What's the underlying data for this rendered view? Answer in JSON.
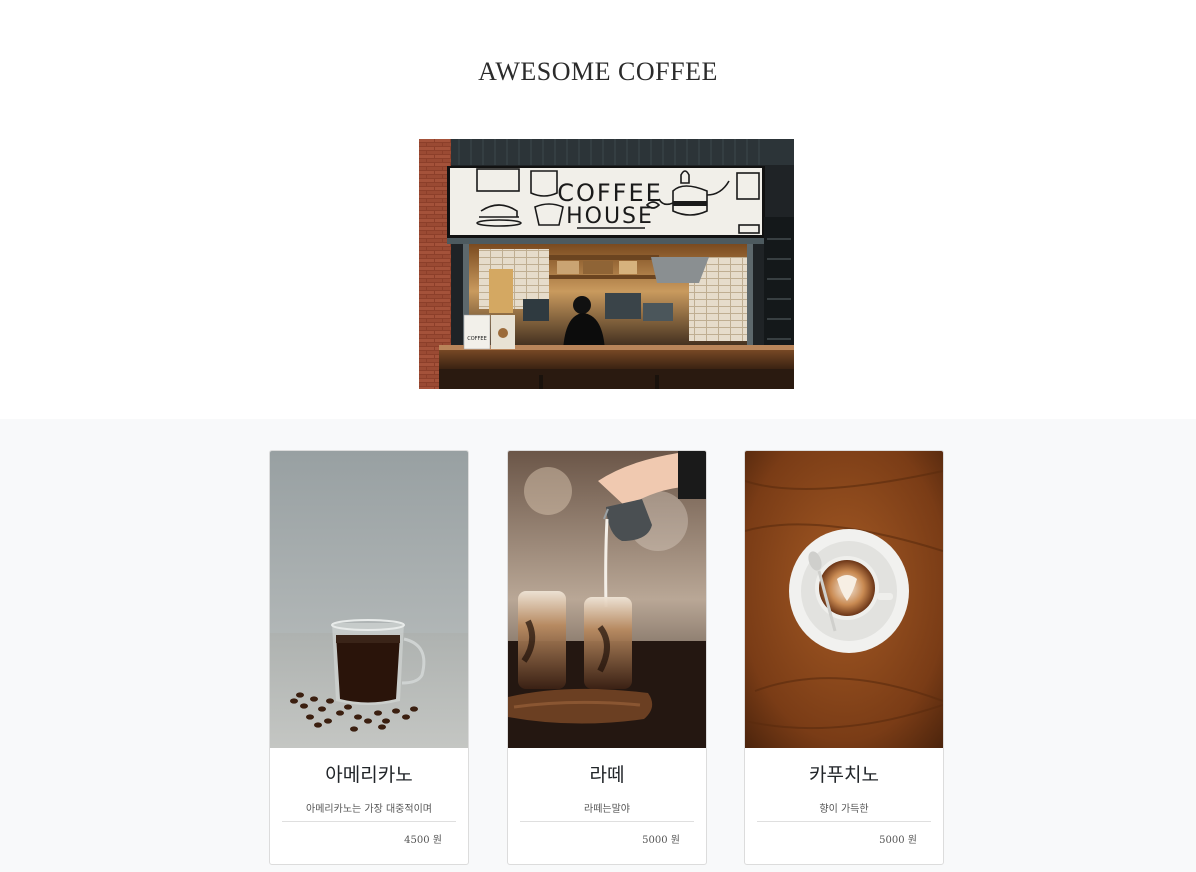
{
  "site": {
    "title": "AWESOME COFFEE"
  },
  "hero": {
    "sign_line1": "COFFEE",
    "sign_line2": "HOUSE",
    "cup_label": "COFFEE"
  },
  "menu": [
    {
      "name": "아메리카노",
      "description": "아메리카노는 가장 대중적이며",
      "price": "4500 원"
    },
    {
      "name": "라떼",
      "description": "라떼는말야",
      "price": "5000 원"
    },
    {
      "name": "카푸치노",
      "description": "향이 가득한",
      "price": "5000 원"
    }
  ]
}
